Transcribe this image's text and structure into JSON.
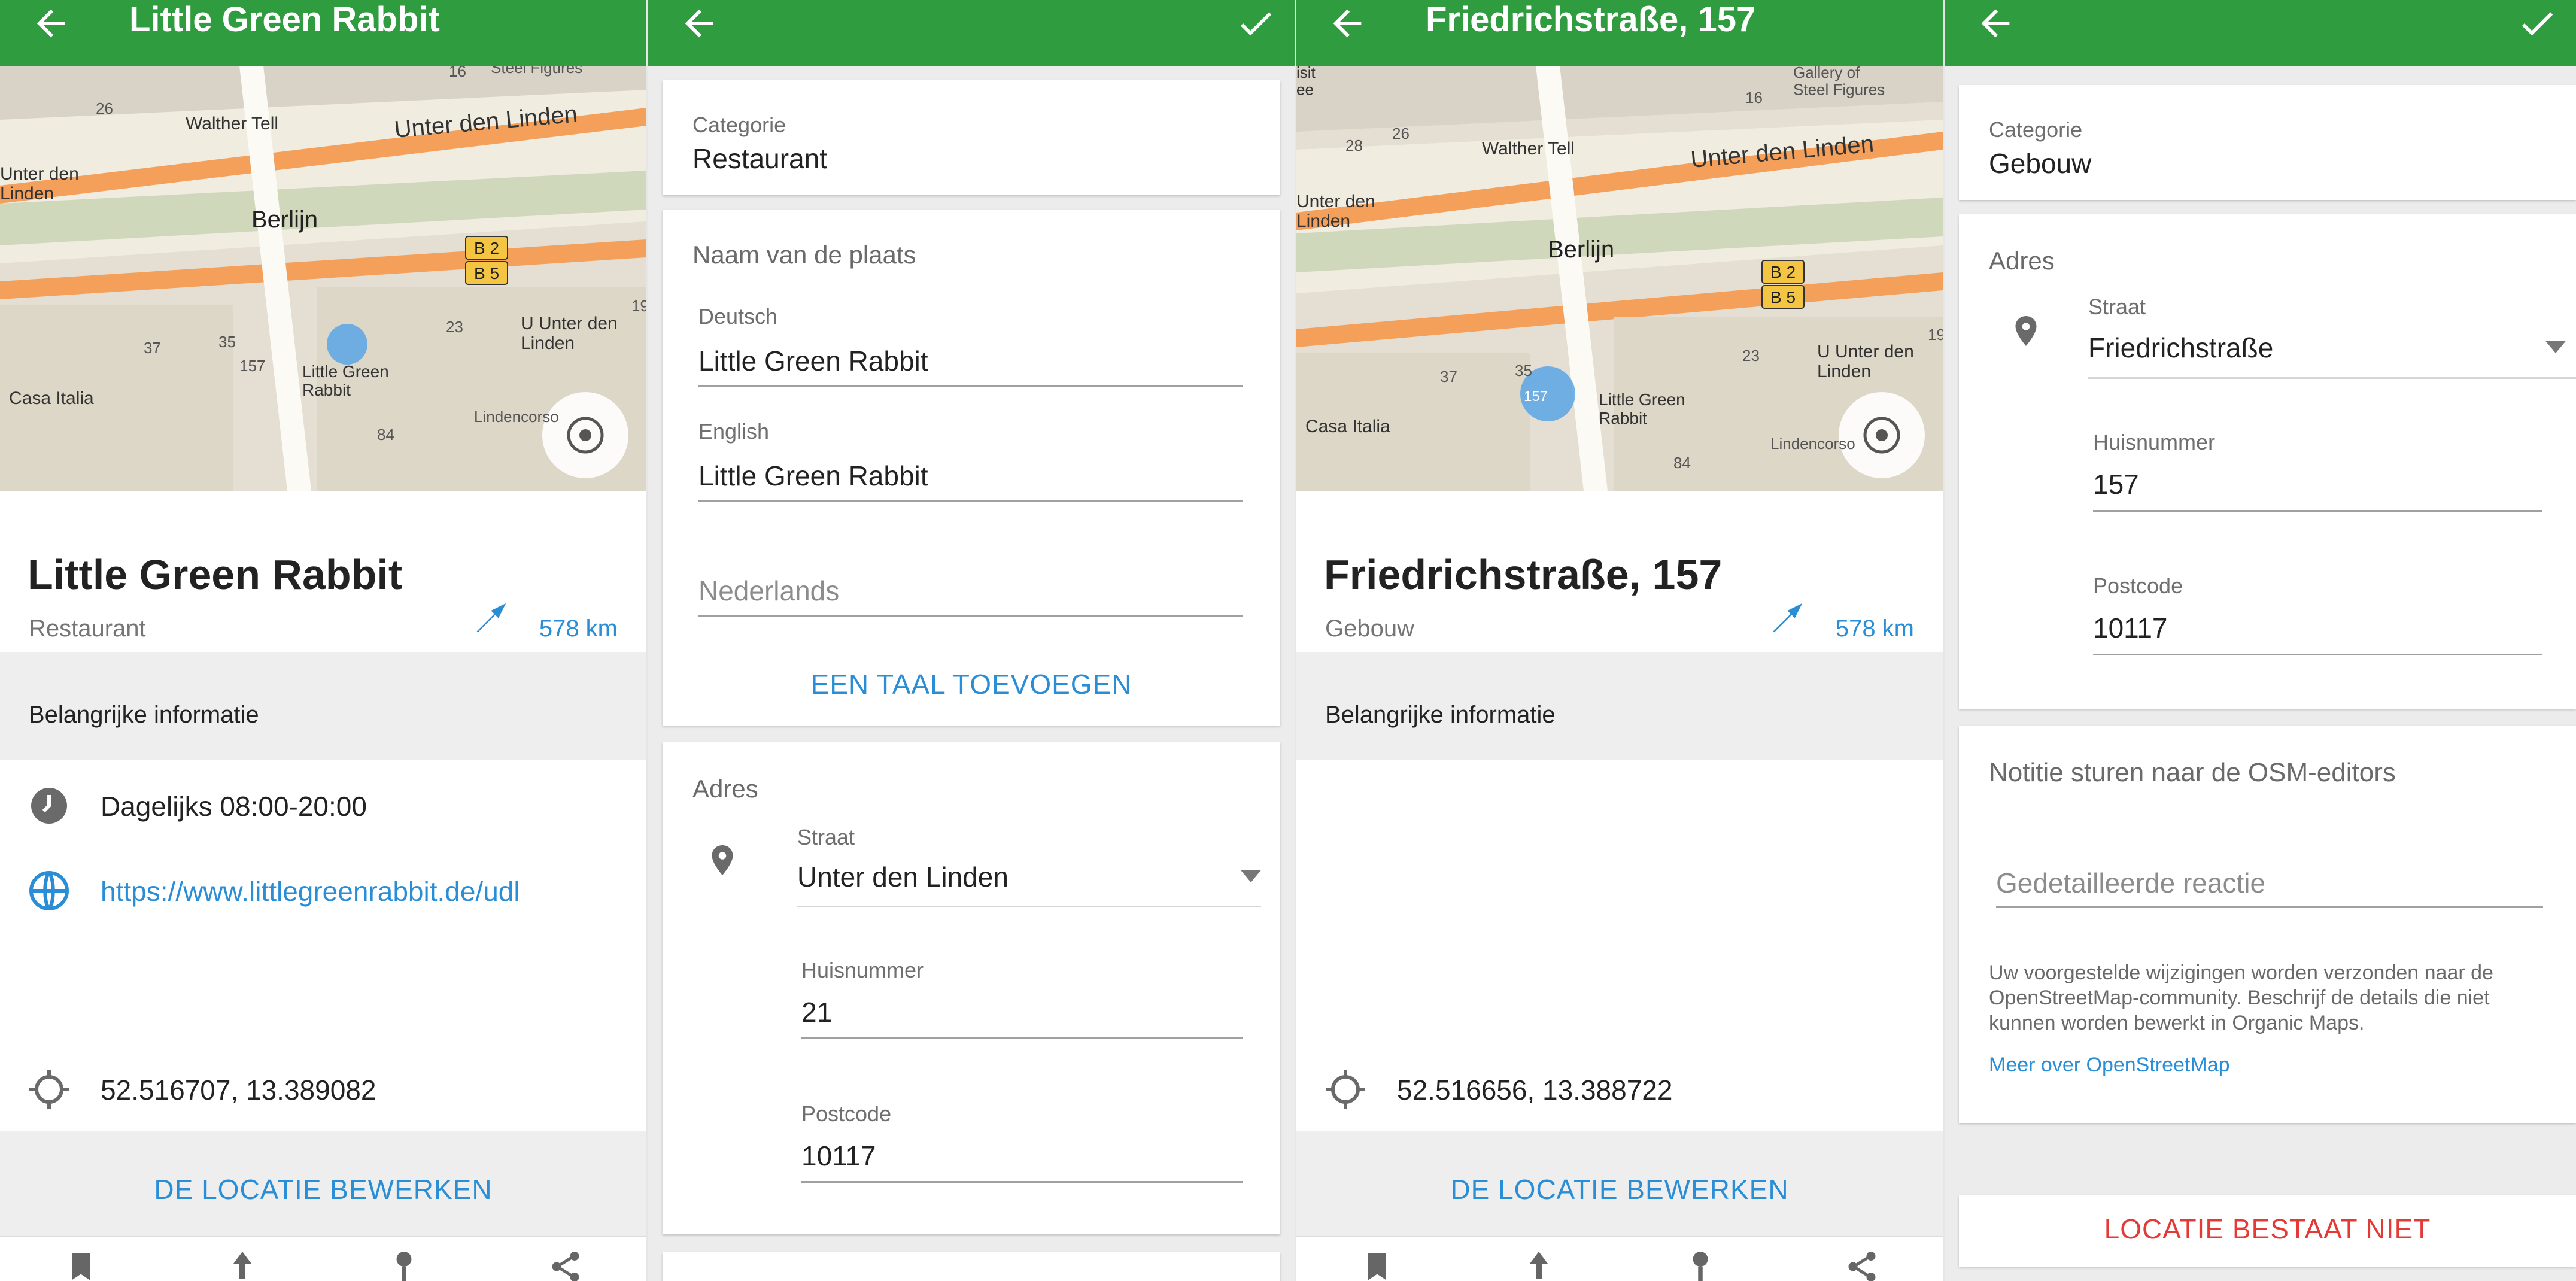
{
  "screens": {
    "s1": {
      "title": "Little Green Rabbit",
      "place_title": "Little Green Rabbit",
      "place_sub": "Restaurant",
      "distance": "578 km",
      "section_header": "Belangrijke informatie",
      "hours": "Dagelijks 08:00-20:00",
      "website": "https://www.littlegreenrabbit.de/udl",
      "coordinates": "52.516707, 13.389082",
      "edit_button": "DE LOCATIE BEWERKEN",
      "map_labels": {
        "street": "Unter den Linden",
        "street_left": "Unter den\nLinden",
        "berlin": "Berlijn",
        "walther": "Walther Tell",
        "casa": "Casa Italia",
        "uunter": "U Unter den\nLinden",
        "lgr": "Little Green\nRabbit",
        "lindencorso": "Lindencorso",
        "steel": "Steel Figures",
        "b2": "B 2",
        "b5": "B 5",
        "n26": "26",
        "n16": "16",
        "n37": "37",
        "n35": "35",
        "n157": "157",
        "n23": "23",
        "n84": "84",
        "n19": "19"
      }
    },
    "s2": {
      "category_label": "Categorie",
      "category_value": "Restaurant",
      "name_header": "Naam van de plaats",
      "lang_de": "Deutsch",
      "value_de": "Little Green Rabbit",
      "lang_en": "English",
      "value_en": "Little Green Rabbit",
      "placeholder_nl": "Nederlands",
      "add_language": "EEN TAAL TOEVOEGEN",
      "address_header": "Adres",
      "street_label": "Straat",
      "street_value": "Unter den Linden",
      "house_label": "Huisnummer",
      "house_value": "21",
      "postcode_label": "Postcode",
      "postcode_value": "10117"
    },
    "s3": {
      "title": "Friedrichstraße, 157",
      "place_title": "Friedrichstraße, 157",
      "place_sub": "Gebouw",
      "distance": "578 km",
      "section_header": "Belangrijke informatie",
      "coordinates": "52.516656, 13.388722",
      "edit_button": "DE LOCATIE BEWERKEN",
      "map_labels": {
        "street": "Unter den Linden",
        "street_left": "Unter den\nLinden",
        "berlin": "Berlijn",
        "walther": "Walther Tell",
        "casa": "Casa Italia",
        "uunter": "U Unter den\nLinden",
        "lgr": "Little Green\nRabbit",
        "lindencorso": "Lindencorso",
        "steel": "Gallery of\nSteel Figures",
        "isit": "isit\nee",
        "b2": "B 2",
        "b5": "B 5",
        "n26": "26",
        "n16": "16",
        "n28": "28",
        "n37": "37",
        "n35": "35",
        "n157": "157",
        "n23": "23",
        "n84": "84",
        "n19": "19"
      }
    },
    "s4": {
      "category_label": "Categorie",
      "category_value": "Gebouw",
      "address_header": "Adres",
      "street_label": "Straat",
      "street_value": "Friedrichstraße",
      "house_label": "Huisnummer",
      "house_value": "157",
      "postcode_label": "Postcode",
      "postcode_value": "10117",
      "note_header": "Notitie sturen naar de OSM-editors",
      "note_placeholder": "Gedetailleerde reactie",
      "note_info": "Uw voorgestelde wijzigingen worden verzonden naar de OpenStreetMap-community. Beschrijf de details die niet kunnen worden bewerkt in Organic Maps.",
      "note_link": "Meer over OpenStreetMap",
      "not_exist_button": "LOCATIE BESTAAT NIET"
    }
  },
  "colors": {
    "appbar": "#2f9d3f",
    "link": "#2a8ed6",
    "danger": "#e53935",
    "map_road_orange": "#f5a05a",
    "map_base": "#e9e4d6"
  },
  "icons": {
    "back": "arrow-left-icon",
    "confirm": "check-icon",
    "clock": "clock-icon",
    "globe": "globe-icon",
    "crosshair": "crosshair-icon",
    "pin": "map-pin-icon",
    "direction": "direction-arrow-icon",
    "bookmark": "bookmark-icon",
    "route_from": "route-from-icon",
    "route_to": "route-to-icon",
    "share": "share-icon",
    "locate": "my-location-icon"
  }
}
